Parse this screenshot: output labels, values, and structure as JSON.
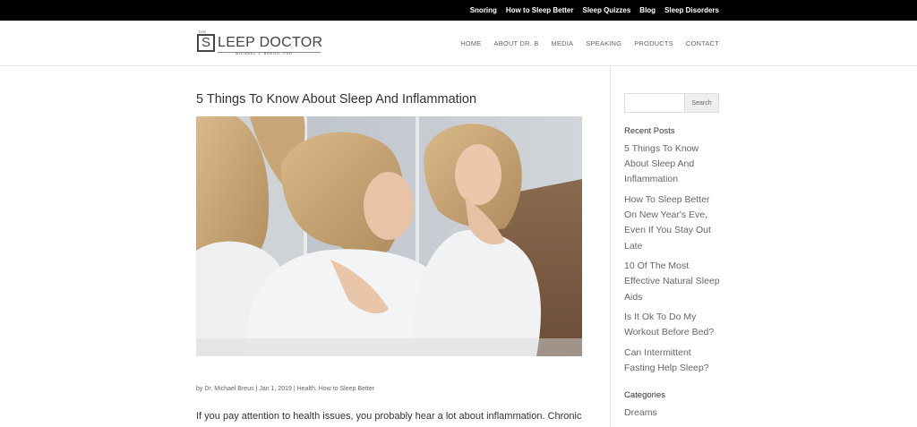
{
  "topbar": {
    "links": [
      "Snoring",
      "How to Sleep Better",
      "Sleep Quizzes",
      "Blog",
      "Sleep Disorders"
    ]
  },
  "header": {
    "logo": {
      "the": "THE",
      "s": "S",
      "word": "LEEP DOCTOR",
      "sub": "MICHAEL J. BREUS, PhD"
    },
    "nav": [
      "HOME",
      "ABOUT DR. B",
      "MEDIA",
      "SPEAKING",
      "PRODUCTS",
      "CONTACT"
    ]
  },
  "post": {
    "title": "5 Things To Know About Sleep And Inflammation",
    "meta_by": "by ",
    "author": "Dr. Michael Breus",
    "sep1": " | ",
    "date": "Jan 1, 2019",
    "sep2": " | ",
    "categories": "Health, How to Sleep Better",
    "excerpt": "If you pay attention to health issues, you probably hear a lot about inflammation. Chronic"
  },
  "sidebar": {
    "search_button": "Search",
    "search_value": "",
    "recent_heading": "Recent Posts",
    "recent_posts": [
      "5 Things To Know About Sleep And Inflammation",
      "How To Sleep Better On New Year's Eve, Even If You Stay Out Late",
      "10 Of The Most Effective Natural Sleep Aids",
      "Is It Ok To Do My Workout Before Bed?",
      "Can Intermittent Fasting Help Sleep?"
    ],
    "categories_heading": "Categories",
    "categories": [
      "Dreams"
    ]
  },
  "colors": {
    "topbar_bg": "#000000",
    "topbar_text": "#ffffff",
    "link_gray": "#666666",
    "title_text": "#333333"
  }
}
